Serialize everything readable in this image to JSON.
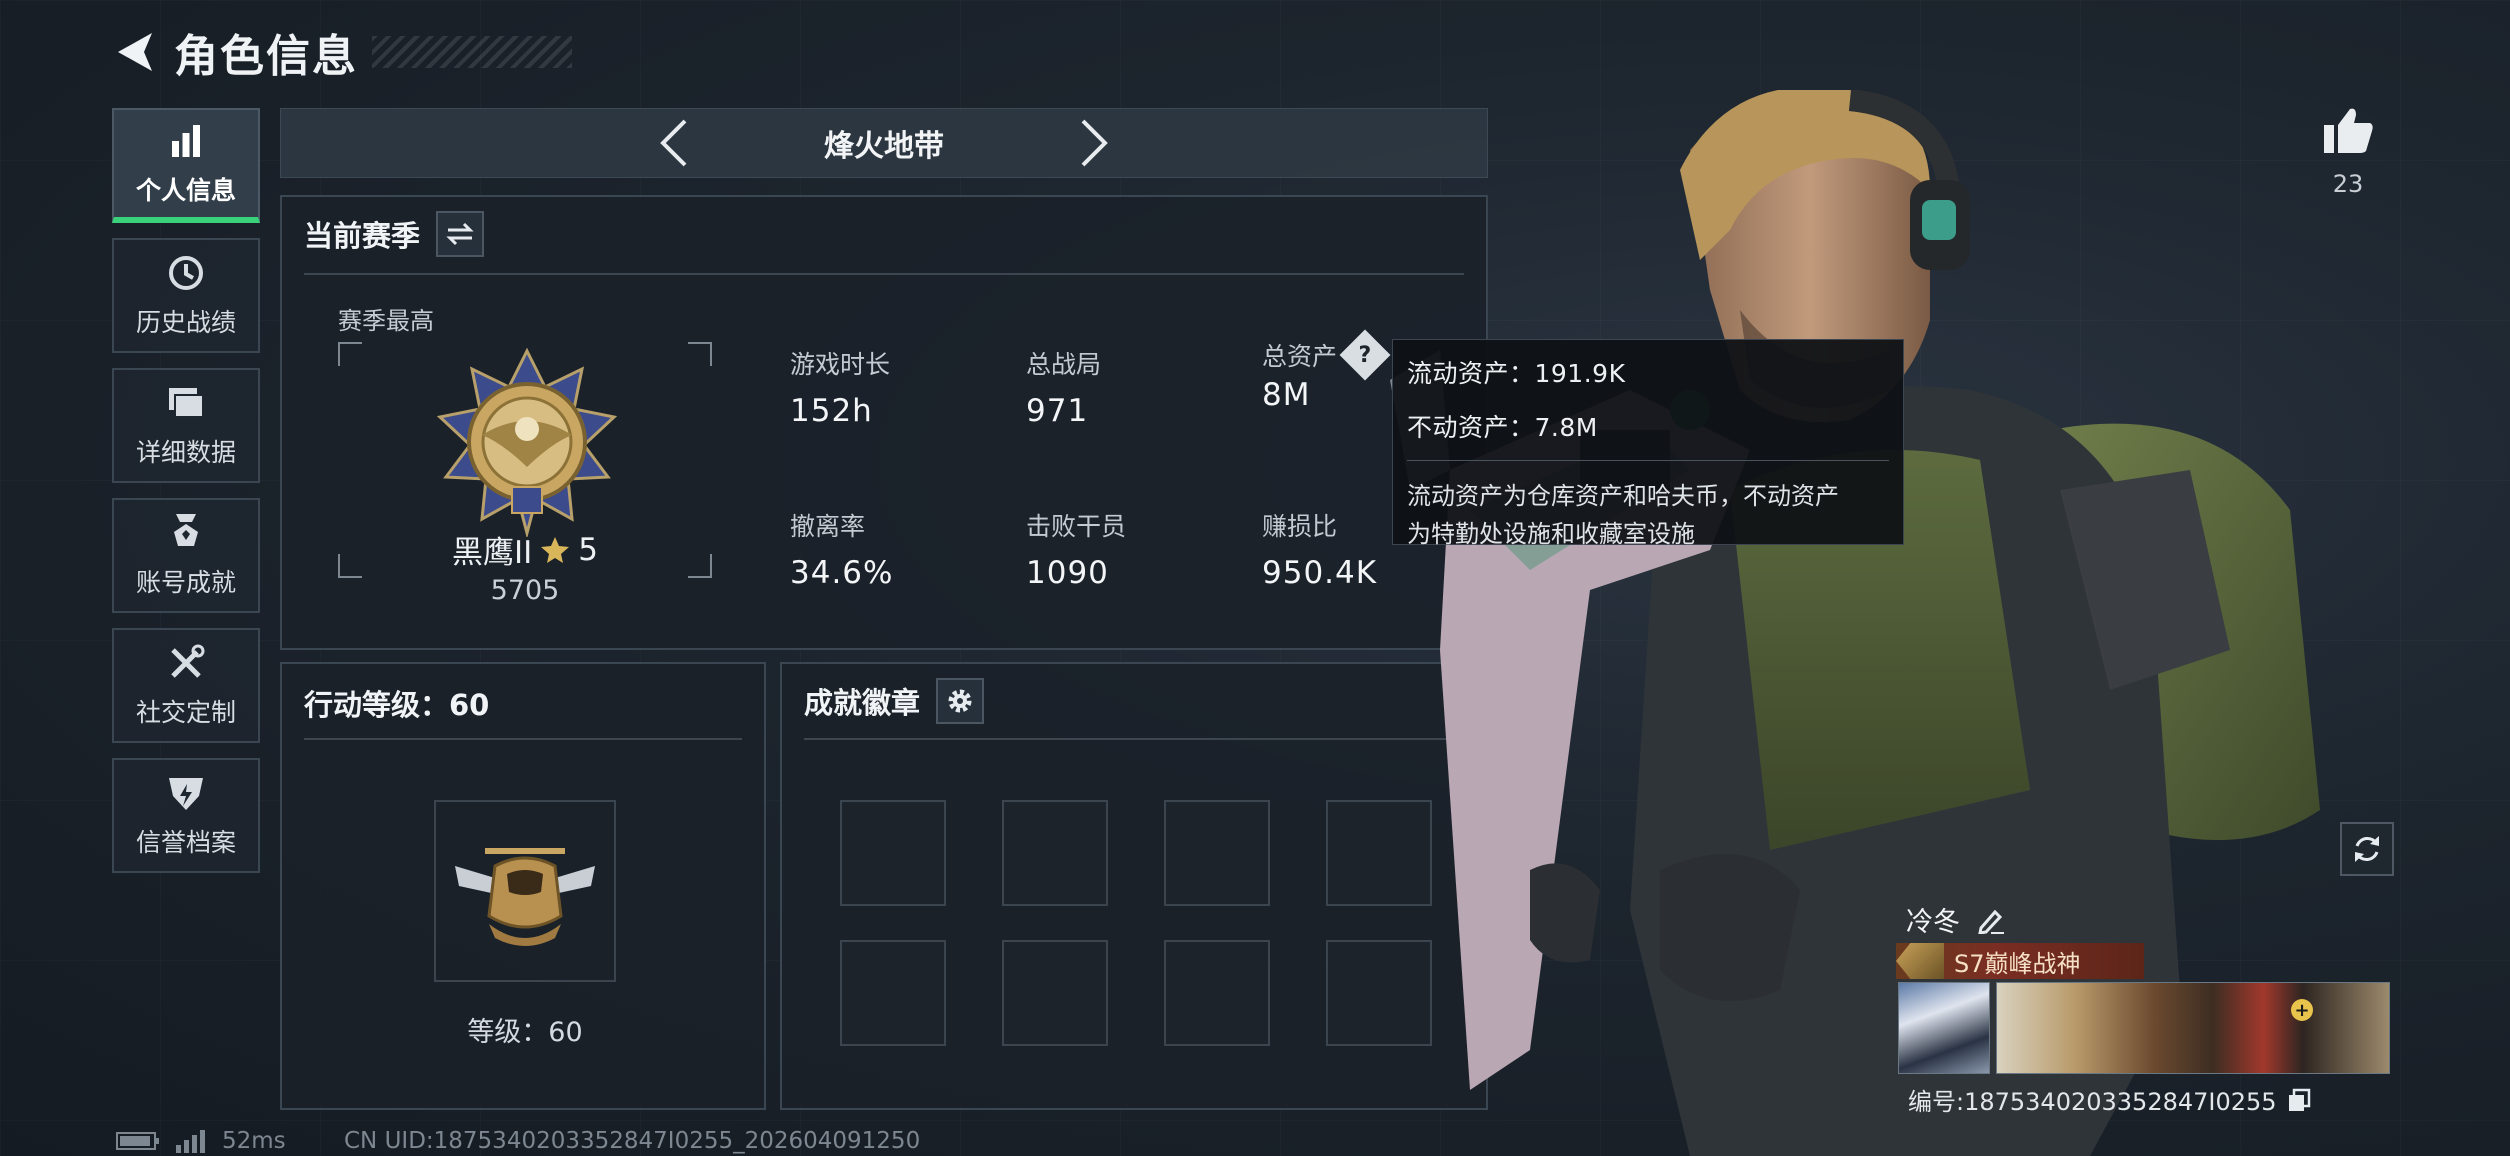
{
  "header": {
    "title": "角色信息"
  },
  "sidebar": {
    "items": [
      {
        "label": "个人信息",
        "icon": "bar-chart-icon",
        "active": true
      },
      {
        "label": "历史战绩",
        "icon": "history-icon",
        "active": false
      },
      {
        "label": "详细数据",
        "icon": "folder-icon",
        "active": false
      },
      {
        "label": "账号成就",
        "icon": "achievement-icon",
        "active": false
      },
      {
        "label": "社交定制",
        "icon": "tools-icon",
        "active": false
      },
      {
        "label": "信誉档案",
        "icon": "credit-icon",
        "active": false
      }
    ]
  },
  "mode": {
    "name": "烽火地带"
  },
  "season": {
    "title": "当前赛季",
    "high_label": "赛季最高",
    "rank_name": "黑鹰II",
    "rank_stars": "5",
    "rank_points": "5705",
    "stats": [
      {
        "label": "游戏时长",
        "value": "152h"
      },
      {
        "label": "总战局",
        "value": "971"
      },
      {
        "label": "总资产",
        "value": "8M"
      },
      {
        "label": "撤离率",
        "value": "34.6%"
      },
      {
        "label": "击败干员",
        "value": "1090"
      },
      {
        "label": "赚损比",
        "value": "950.4K"
      }
    ]
  },
  "tooltip": {
    "liquid": "流动资产：191.9K",
    "fixed": "不动资产：7.8M",
    "desc_line1": "流动资产为仓库资产和哈夫币，不动资产",
    "desc_line2": "为特勤处设施和收藏室设施"
  },
  "action": {
    "title": "行动等级：60",
    "level_text": "等级：60"
  },
  "badges": {
    "title": "成就徽章"
  },
  "likes": {
    "count": "23"
  },
  "player": {
    "name": "冷冬",
    "title_plate": "S7巅峰战神",
    "uid": "编号:1875340203352847I0255"
  },
  "status": {
    "ping": "52ms",
    "uid_footer": "CN UID:1875340203352847I0255_202604091250"
  },
  "colors": {
    "accent_green": "#39d27a",
    "panel_border": "#3a4652",
    "background": "#1c242d"
  }
}
